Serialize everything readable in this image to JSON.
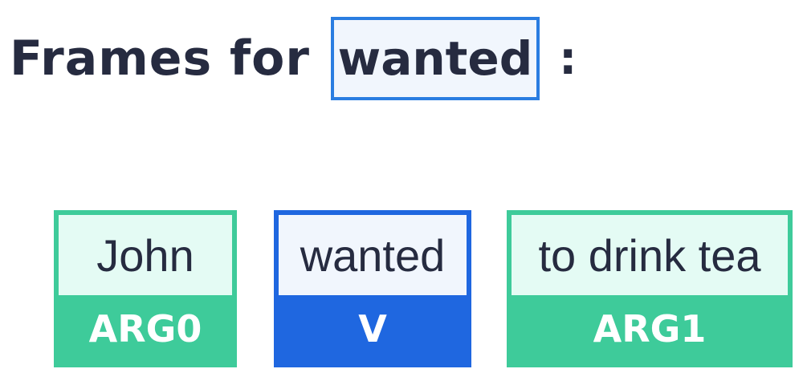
{
  "title": {
    "prefix": "Frames for",
    "verb": "wanted",
    "colon": ":"
  },
  "frames": [
    {
      "text": "John",
      "role": "ARG0",
      "kind": "argument",
      "color": "#3ecb9a"
    },
    {
      "text": "wanted",
      "role": "V",
      "kind": "verb",
      "color": "#1f67e0"
    },
    {
      "text": "to drink tea",
      "role": "ARG1",
      "kind": "argument",
      "color": "#3ecb9a"
    }
  ]
}
